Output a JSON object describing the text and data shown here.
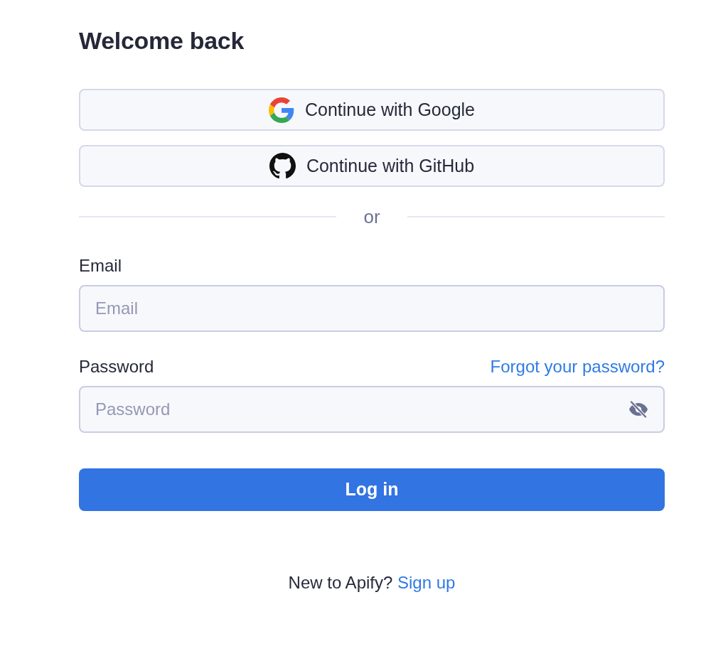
{
  "heading": "Welcome back",
  "social_buttons": [
    {
      "kind": "google",
      "label": "Continue with Google"
    },
    {
      "kind": "github",
      "label": "Continue with GitHub"
    }
  ],
  "divider": {
    "label": "or"
  },
  "fields": [
    {
      "kind": "email",
      "label": "Email",
      "placeholder": "Email"
    },
    {
      "kind": "password",
      "label": "Password",
      "placeholder": "Password",
      "link": "Forgot your password?"
    }
  ],
  "submit_button": {
    "label": "Log in"
  },
  "footer": {
    "text": "New to Apify?",
    "link": "Sign up"
  }
}
